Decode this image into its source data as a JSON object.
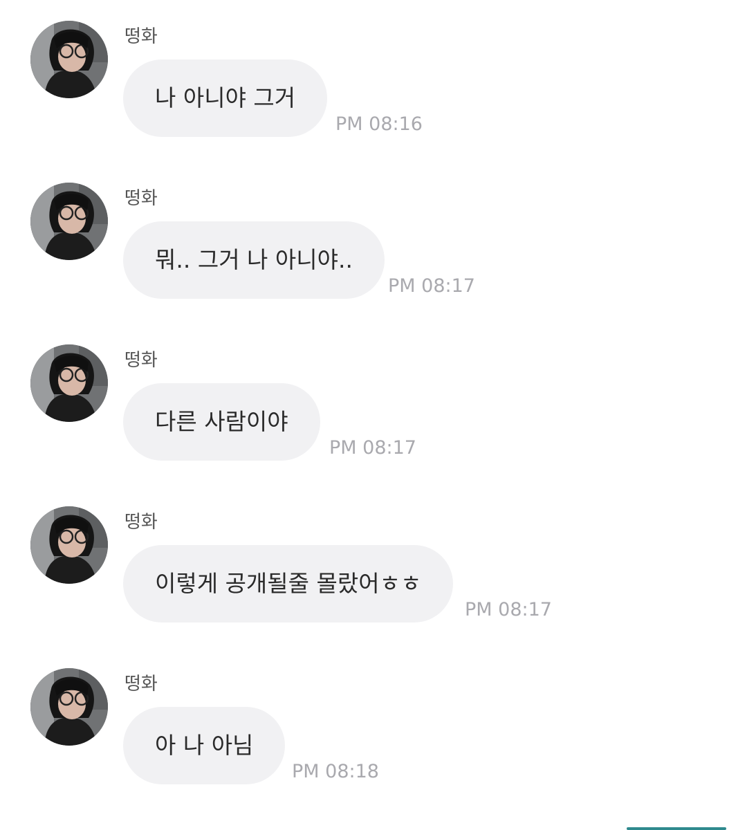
{
  "messages": [
    {
      "sender": "떵화",
      "text": "나 아니야 그거",
      "time": "PM 08:16"
    },
    {
      "sender": "떵화",
      "text": "뭐.. 그거 나 아니야..",
      "time": "PM 08:17"
    },
    {
      "sender": "떵화",
      "text": "다른 사람이야",
      "time": "PM 08:17"
    },
    {
      "sender": "떵화",
      "text": "이렇게 공개될줄 몰랐어ㅎㅎ",
      "time": "PM 08:17"
    },
    {
      "sender": "떵화",
      "text": "아 나 아님",
      "time": "PM 08:18"
    }
  ],
  "colors": {
    "bubble": "#f1f1f3",
    "text": "#2a2a2a",
    "time": "#a9a9ae",
    "sender": "#555555"
  }
}
